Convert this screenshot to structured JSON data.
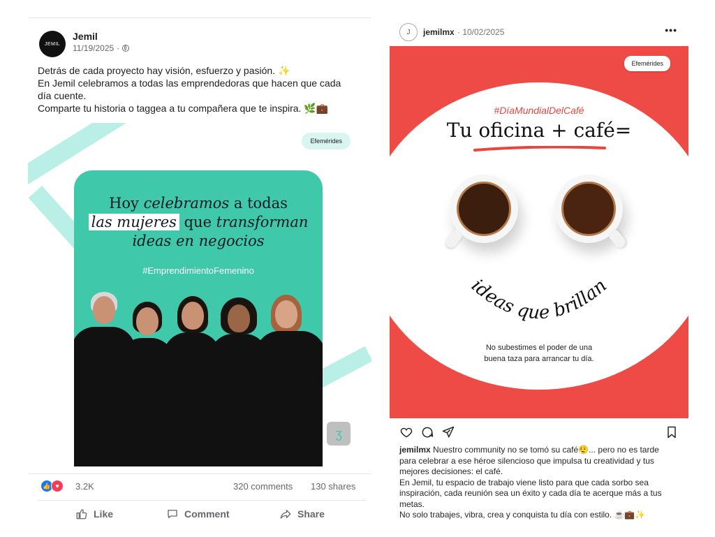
{
  "facebook": {
    "author": "Jemil",
    "avatar_text": "JEMIL",
    "date": "11/19/2025",
    "privacy_icon": "globe-icon",
    "text_lines": [
      "Detrás de cada proyecto hay visión, esfuerzo y pasión. ✨",
      "En Jemil celebramos a todas las emprendedoras que hacen que cada",
      "día cuente.",
      "Comparte tu historia o taggea a tu compañera que te inspira. 🌿💼"
    ],
    "image": {
      "badge": "Efemérides",
      "headline_1a": "Hoy ",
      "headline_1b": "celebramos",
      "headline_1c": " a todas",
      "headline_2a": "las mujeres",
      "headline_2b": " que ",
      "headline_2c": "transforman",
      "headline_3": "ideas en negocios",
      "hashtag": "#EmprendimientoFemenino",
      "accent_color": "#3fc8a9"
    },
    "reactions_count": "3.2K",
    "comments": "320 comments",
    "shares": "130 shares",
    "actions": {
      "like": "Like",
      "comment": "Comment",
      "share": "Share"
    }
  },
  "instagram": {
    "avatar_text": "J",
    "username": "jemilmx",
    "date": " · 10/02/2025",
    "more": "•••",
    "image": {
      "badge": "Efemérides",
      "hashtag": "#DíaMundialDelCafé",
      "title": "Tu oficina + café=",
      "arc_text": "ideas que brillan",
      "sub_line_1": "No subestimes el poder de una",
      "sub_line_2": "buena taza para arrancar tu día.",
      "background_color": "#ee4a46"
    },
    "caption_user": "jemilmx",
    "caption_lines": [
      " Nuestro community no se tomó su café😮‍💨... pero no es tarde",
      "para celebrar a ese héroe silencioso que impulsa tu creatividad y tus",
      "mejores decisiones: el café.",
      "En Jemil, tu espacio de trabajo viene listo para que cada sorbo sea",
      "inspiración, cada reunión sea un éxito y cada día te acerque más a tus",
      "metas.",
      "No solo trabajes, vibra, crea y conquista tu día con estilo. ☕💼✨"
    ]
  }
}
